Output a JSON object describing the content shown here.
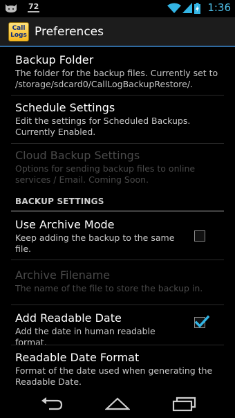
{
  "status_bar": {
    "notification_count": "72",
    "time": "1:36",
    "icons": [
      "cat-notification-icon",
      "wifi-icon",
      "signal-icon",
      "battery-icon"
    ]
  },
  "action_bar": {
    "app_icon_line1": "Call",
    "app_icon_line2": "Logs",
    "title": "Preferences"
  },
  "preferences": [
    {
      "title": "Backup Folder",
      "summary": "The folder for the backup files. Currently set to /storage/sdcard0/CallLogBackupRestore/.",
      "enabled": true
    },
    {
      "title": "Schedule Settings",
      "summary": "Edit the settings for Scheduled Backups. Currently Enabled.",
      "enabled": true
    },
    {
      "title": "Cloud Backup Settings",
      "summary": "Options for sending backup files to online services / Email. Coming Soon.",
      "enabled": false
    }
  ],
  "section_header": "BACKUP SETTINGS",
  "backup_settings": [
    {
      "title": "Use Archive Mode",
      "summary": "Keep adding the backup to the same file.",
      "checked": false,
      "enabled": true
    },
    {
      "title": "Archive Filename",
      "summary": "The name of the file to store the backup in.",
      "enabled": false
    },
    {
      "title": "Add Readable Date",
      "summary": "Add the date in human readable format.",
      "checked": true,
      "enabled": true
    },
    {
      "title": "Readable Date Format",
      "summary": "Format of the date used when generating the Readable Date.",
      "enabled": true
    }
  ],
  "colors": {
    "accent": "#33b5e5",
    "clock": "#4fc1ea",
    "action_bar_underline": "#2f6aa0"
  }
}
